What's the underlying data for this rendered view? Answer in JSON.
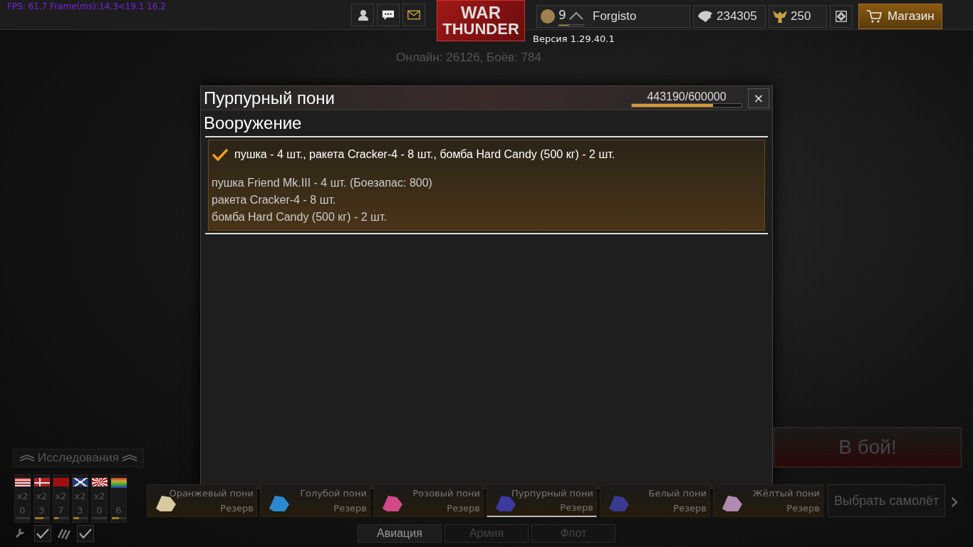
{
  "debug": {
    "fps": "FPS: 61.7 Frame(ms):14.3<19.1 16.2"
  },
  "top_bar": {
    "logo": {
      "line1": "WAR",
      "line2": "THUNDER"
    },
    "version": "Версия 1.29.40.1",
    "player": {
      "rank": "9",
      "name": "Forgisto",
      "level": 0.4
    },
    "silver": "234305",
    "gold": "250",
    "shop": "Магазин"
  },
  "online": "Онлайн: 26126, Боёв: 784",
  "modal": {
    "title": "Пурпурный пони",
    "progress_text": "443190/600000",
    "level": 0.739,
    "close": "×",
    "section": "Вооружение",
    "presets": [
      {
        "selected": true,
        "summary": "пушка - 4 шт., ракета Cracker-4 - 8 шт., бомба Hard Candy (500 кг) - 2 шт.",
        "items": [
          "пушка Friend Mk.III - 4 шт. (Боезапас: 800)",
          "ракета Cracker-4 - 8 шт.",
          "бомба Hard Candy (500 кг) - 2 шт."
        ]
      }
    ]
  },
  "research": {
    "title": "Исследования",
    "countries": [
      {
        "kind": "usa",
        "multiplier": "x2",
        "count": "0",
        "level": 0.0
      },
      {
        "kind": "nordic",
        "multiplier": "x2",
        "count": "3",
        "level": 0.6
      },
      {
        "kind": "red",
        "multiplier": "x2",
        "count": "7",
        "level": 0.3
      },
      {
        "kind": "uk",
        "multiplier": "x2",
        "count": "3",
        "level": 0.4
      },
      {
        "kind": "japan",
        "multiplier": "x2",
        "count": "0",
        "level": 0.0
      },
      {
        "kind": "rainbow",
        "count": "6",
        "level": 0.5
      }
    ]
  },
  "battle_button": "В бой!",
  "slots": [
    {
      "name": "Оранжевый пони",
      "status": "Резерв",
      "color": "#d8c9a0",
      "selected": false
    },
    {
      "name": "Голубой пони",
      "status": "Резерв",
      "color": "#2a8ad0",
      "selected": false
    },
    {
      "name": "Розовый пони",
      "status": "Резерв",
      "color": "#d04a8a",
      "selected": false
    },
    {
      "name": "Пурпурный пони",
      "status": "Резерв",
      "color": "#3a3aa0",
      "selected": true
    },
    {
      "name": "Белый пони",
      "status": "Резерв",
      "color": "#3a3a90",
      "selected": false
    },
    {
      "name": "Жёлтый пони",
      "status": "Резерв",
      "color": "#b08ab0",
      "selected": false
    }
  ],
  "select_aircraft": "Выбрать самолёт",
  "next_arrow": "›",
  "tabs": [
    {
      "label": "Авиация",
      "selected": true
    },
    {
      "label": "Армия",
      "selected": false
    },
    {
      "label": "Флот",
      "selected": false
    }
  ],
  "filters": [
    {
      "kind": "wrench",
      "checked": true
    },
    {
      "kind": "ammo",
      "checked": true
    }
  ]
}
